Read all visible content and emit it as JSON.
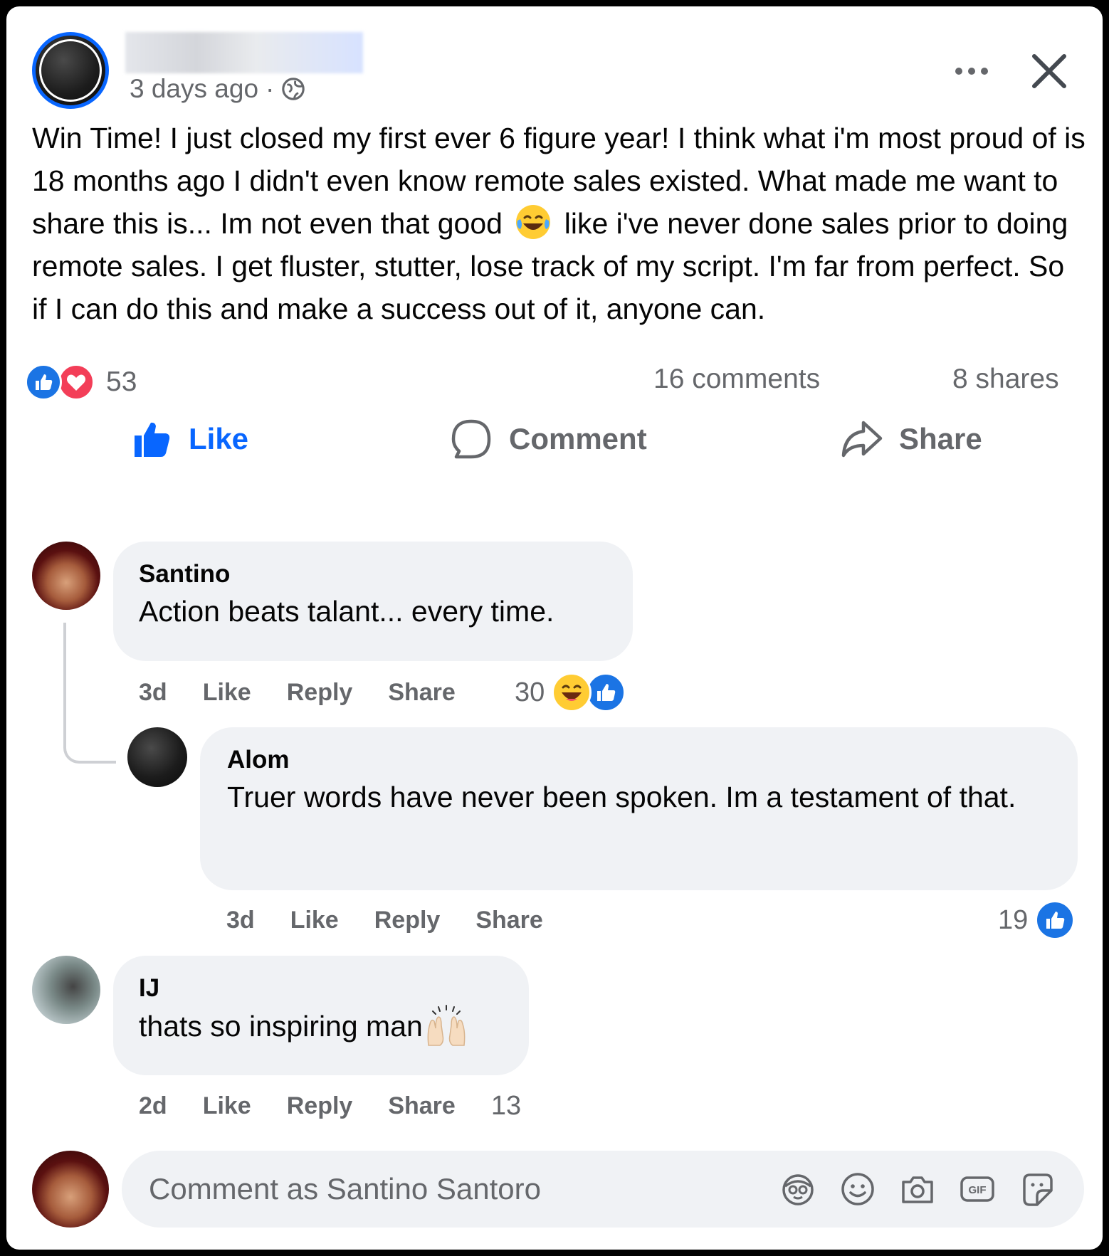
{
  "post": {
    "time": "3 days ago",
    "separator": "·",
    "icons": {
      "privacy": "globe-icon",
      "more": "more-dots-icon",
      "close": "close-icon"
    },
    "text": "Win Time! I just closed my first ever 6 figure year! I think what i'm most proud of is 18 months ago I didn't even know remote sales existed. What made me want to share this is... Im not even that good",
    "text_tail": "like i've never done sales prior to doing remote sales. I get fluster, stutter, lose track of my script. I'm far from perfect. So if I can do this and make a success out of it, anyone can.",
    "reactions": {
      "count": "53",
      "icons": [
        "like-reaction-icon",
        "love-reaction-icon"
      ]
    },
    "comments_count": "16 comments",
    "shares_count": "8 shares"
  },
  "actions": {
    "like": "Like",
    "comment": "Comment",
    "share": "Share"
  },
  "colors": {
    "accent": "#0866ff",
    "secondary_text": "#65676b",
    "bubble": "#f0f2f5",
    "love": "#f33e58"
  },
  "comments": [
    {
      "author": "Santino",
      "text": "Action beats talant... every time.",
      "time": "3d",
      "like": "Like",
      "reply": "Reply",
      "share": "Share",
      "reaction_count": "30",
      "reaction_icons": [
        "haha-reaction-icon",
        "like-reaction-icon"
      ],
      "replies": [
        {
          "author": "Alom",
          "text": "Truer words have never been spoken. Im a testament of that.",
          "time": "3d",
          "like": "Like",
          "reply": "Reply",
          "share": "Share",
          "reaction_count": "19",
          "reaction_icons": [
            "like-reaction-icon"
          ]
        }
      ]
    },
    {
      "author": "IJ",
      "text": "thats so inspiring man",
      "time": "2d",
      "like": "Like",
      "reply": "Reply",
      "share": "Share",
      "reaction_count": "13"
    }
  ],
  "composer": {
    "placeholder": "Comment as Santino Santoro",
    "icons": [
      "avatar-sticker-icon",
      "emoji-icon",
      "camera-icon",
      "gif-icon",
      "sticker-icon"
    ]
  }
}
